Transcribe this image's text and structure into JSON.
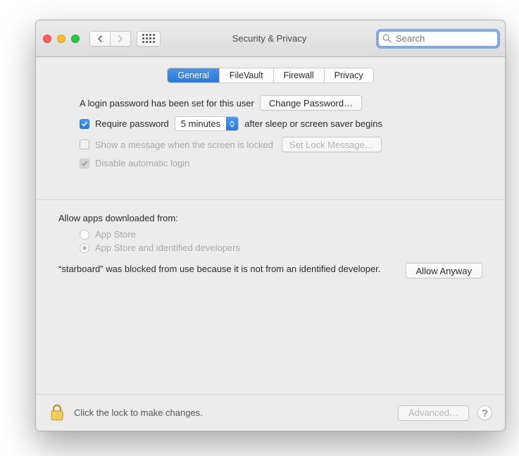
{
  "window_title": "Security & Privacy",
  "search": {
    "placeholder": "Search"
  },
  "tabs": [
    {
      "label": "General",
      "active": true
    },
    {
      "label": "FileVault",
      "active": false
    },
    {
      "label": "Firewall",
      "active": false
    },
    {
      "label": "Privacy",
      "active": false
    }
  ],
  "login": {
    "message": "A login password has been set for this user",
    "change_button": "Change Password…",
    "require_label": "Require password",
    "require_checked": true,
    "delay_value": "5 minutes",
    "after_sleep": "after sleep or screen saver begins",
    "show_message_label": "Show a message when the screen is locked",
    "show_message_checked": false,
    "set_lock_button": "Set Lock Message…",
    "disable_auto_label": "Disable automatic login",
    "disable_auto_checked": true
  },
  "allow_apps": {
    "heading": "Allow apps downloaded from:",
    "options": [
      {
        "label": "App Store",
        "selected": false
      },
      {
        "label": "App Store and identified developers",
        "selected": true
      }
    ],
    "blocked_text": "“starboard” was blocked from use because it is not from an identified developer.",
    "allow_button": "Allow Anyway"
  },
  "footer": {
    "lock_text": "Click the lock to make changes.",
    "advanced_button": "Advanced…"
  }
}
